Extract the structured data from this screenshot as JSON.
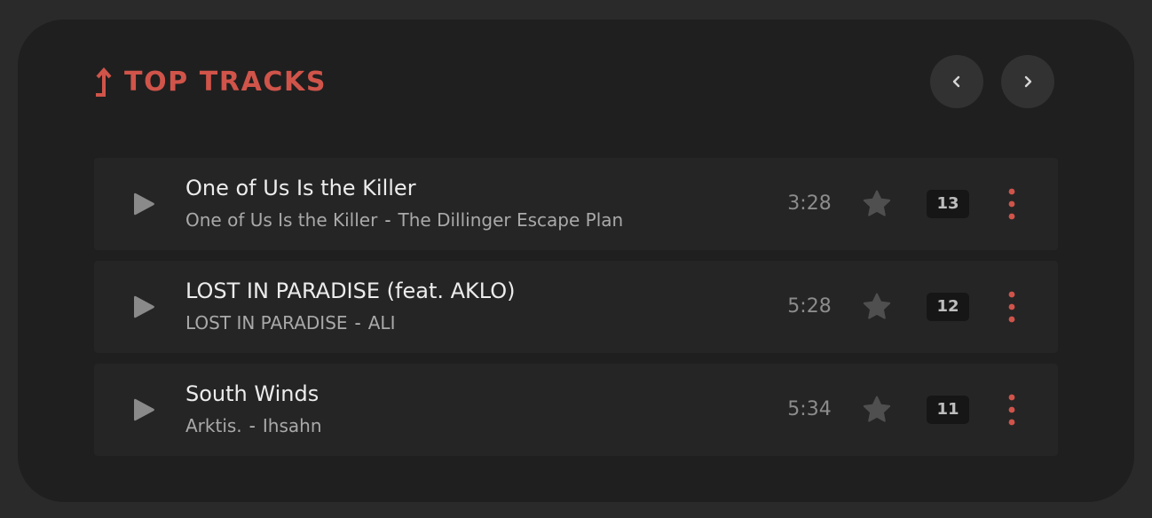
{
  "section": {
    "title": "TOP TRACKS",
    "title_icon": "trending-up-arrow-icon",
    "accent_color": "#d0544a"
  },
  "nav": {
    "prev_icon": "chevron-left-icon",
    "next_icon": "chevron-right-icon"
  },
  "tracks": [
    {
      "title": "One of Us Is the Killer",
      "album": "One of Us Is the Killer",
      "separator": "-",
      "artist": "The Dillinger Escape Plan",
      "duration": "3:28",
      "count": "13"
    },
    {
      "title": "LOST IN PARADISE (feat. AKLO)",
      "album": "LOST IN PARADISE",
      "separator": "-",
      "artist": "ALI",
      "duration": "5:28",
      "count": "12"
    },
    {
      "title": "South Winds",
      "album": "Arktis.",
      "separator": "-",
      "artist": "Ihsahn",
      "duration": "5:34",
      "count": "11"
    }
  ]
}
